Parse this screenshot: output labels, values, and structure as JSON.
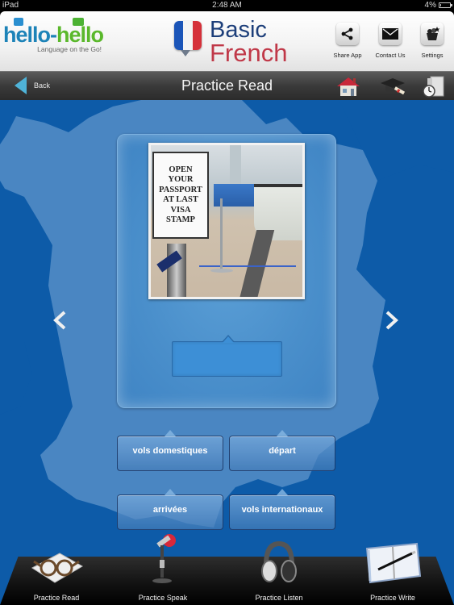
{
  "status_bar": {
    "device": "iPad",
    "time": "2:48 AM",
    "battery_text": "4%",
    "battery_level": 0.04
  },
  "header": {
    "brand": {
      "logo_part1": "hello",
      "logo_dash": "-",
      "logo_part2": "hello",
      "tagline": "Language on the Go!"
    },
    "product": {
      "line1": "Basic",
      "line2": "French",
      "flag_colors": [
        "#1b55b8",
        "#f4f4f4",
        "#d5313a"
      ]
    },
    "buttons": [
      {
        "label": "Share App",
        "icon": "share-icon"
      },
      {
        "label": "Contact Us",
        "icon": "envelope-icon"
      },
      {
        "label": "Settings",
        "icon": "settings-icon"
      }
    ]
  },
  "navbar": {
    "back_label": "Back",
    "title": "Practice Read",
    "icons": [
      "home-icon",
      "graduation-cap-icon",
      "book-clock-icon"
    ]
  },
  "card": {
    "image_sign_text": "OPEN\nYOUR\nPASSPORT\nAT LAST\nVISA\nSTAMP",
    "answer_value": ""
  },
  "choices": [
    {
      "label": "vols domestiques"
    },
    {
      "label": "départ"
    },
    {
      "label": "arrivées"
    },
    {
      "label": "vols internationaux"
    }
  ],
  "tabs": [
    {
      "label": "Practice Read",
      "icon": "reading-glasses-icon",
      "active": true
    },
    {
      "label": "Practice Speak",
      "icon": "microphone-icon",
      "active": false
    },
    {
      "label": "Practice Listen",
      "icon": "headphones-icon",
      "active": false
    },
    {
      "label": "Practice Write",
      "icon": "notebook-pen-icon",
      "active": false
    }
  ],
  "colors": {
    "background_blue": "#0d5ba8",
    "map_blue": "#4a86c2",
    "back_arrow": "#4fb3d8",
    "brand_blue": "#1d83b8",
    "brand_green": "#5ab82b",
    "basic_text": "#1d3f7a",
    "french_text": "#c03848"
  }
}
